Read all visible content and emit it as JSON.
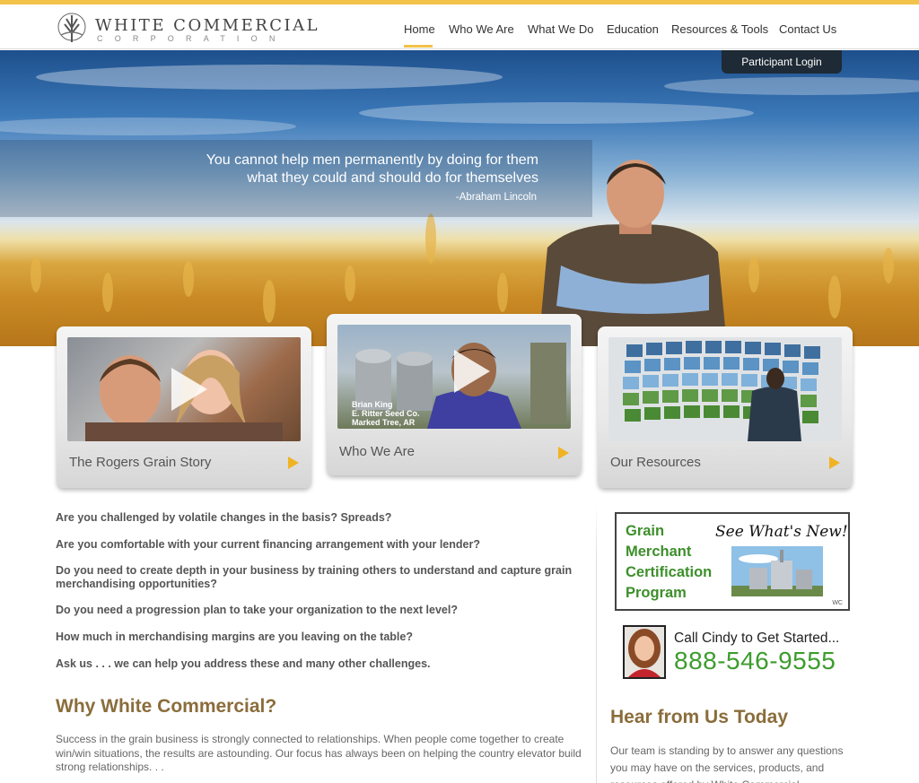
{
  "brand": {
    "name": "White Commercial",
    "sub": "Corporation"
  },
  "nav": {
    "items": [
      "Home",
      "Who We Are",
      "What We Do",
      "Education",
      "Resources & Tools",
      "Contact Us"
    ],
    "active": "Home"
  },
  "hero": {
    "login_label": "Participant Login",
    "quote_line1": "You cannot help men permanently by doing for them",
    "quote_line2": "what they could and should do for themselves",
    "quote_attr": "-Abraham Lincoln"
  },
  "cards": [
    {
      "label": "The Rogers Grain Story"
    },
    {
      "label": "Who We Are",
      "caption_name": "Brian King",
      "caption_company": "E. Ritter Seed Co.",
      "caption_place": "Marked Tree, AR"
    },
    {
      "label": "Our Resources"
    }
  ],
  "questions": [
    "Are you challenged by volatile changes in the basis?  Spreads?",
    "Are you comfortable with your current financing arrangement with your lender?",
    "Do you need to create depth in your business by training others to understand and capture grain merchandising opportunities?",
    "Do you need a progression plan to take your organization to the next level?",
    "How much in merchandising margins are you leaving on the table?",
    "Ask us . . . we can help you address these and many other challenges."
  ],
  "why": {
    "title": "Why White Commercial?",
    "body": "Success in the grain business is strongly connected to relationships. When people come together to create win/win situations, the results are astounding. Our focus has always been on helping the country elevator build strong relationships. . ."
  },
  "gmc": {
    "line1": "Grain",
    "line2": "Merchant",
    "line3": "Certification",
    "line4": "Program",
    "new_text": "See What's New!",
    "mark": "WC"
  },
  "cindy": {
    "text": "Call Cindy to Get Started...",
    "phone": "888-546-9555"
  },
  "hear": {
    "title": "Hear from Us Today",
    "body": "Our team is standing by to answer any questions you may have on the services, products, and resources offered by White Commercial."
  },
  "colors": {
    "accent": "#f2c24a",
    "heading": "#8a6d3b",
    "green": "#3d9c2e"
  }
}
